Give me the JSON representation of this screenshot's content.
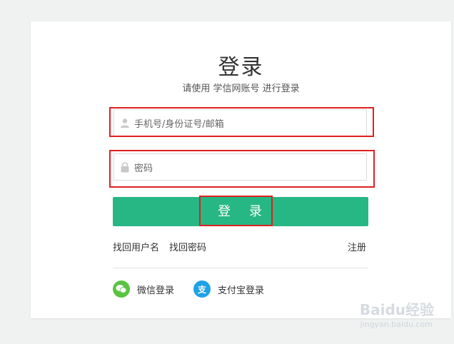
{
  "login": {
    "title": "登录",
    "subtitle": "请使用 学信网账号 进行登录",
    "phone_placeholder": "手机号/身份证号/邮箱",
    "password_placeholder": "密码",
    "login_button": "登 录",
    "find_username": "找回用户名",
    "find_password": "找回密码",
    "register": "注册",
    "wechat_login": "微信登录",
    "alipay_login": "支付宝登录",
    "alipay_icon_char": "支"
  },
  "watermark": {
    "brand": "Baidu经验",
    "url": "jingyan.baidu.com"
  },
  "colors": {
    "primary": "#26b784",
    "highlight": "#e02020",
    "wechat": "#5ac341",
    "alipay": "#1fa2e7"
  }
}
